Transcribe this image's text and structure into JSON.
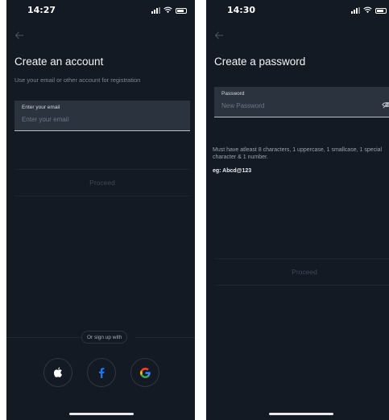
{
  "colors": {
    "background": "#141a24",
    "field_bg": "#2b333f",
    "text_primary": "#f2f4f7",
    "text_muted": "#7c8594",
    "proceed_disabled_text": "#3f4856",
    "facebook_blue": "#1877f2",
    "google_blue": "#4285f4",
    "google_red": "#ea4335",
    "google_yellow": "#fbbc05",
    "google_green": "#34a853"
  },
  "left_screen": {
    "status": {
      "time": "14:27"
    },
    "back_icon": "arrow-left-icon",
    "title": "Create an account",
    "subtitle": "Use your email or other account for registration",
    "email_field": {
      "label": "Enter your email",
      "placeholder": "Enter your email",
      "value": ""
    },
    "proceed_label": "Proceed",
    "or_sign_up": "Or sign up with",
    "social": [
      {
        "name": "apple",
        "icon": "apple-icon"
      },
      {
        "name": "facebook",
        "icon": "facebook-icon"
      },
      {
        "name": "google",
        "icon": "google-icon"
      }
    ]
  },
  "right_screen": {
    "status": {
      "time": "14:30"
    },
    "back_icon": "arrow-left-icon",
    "title": "Create a password",
    "password_field": {
      "label": "Password",
      "placeholder": "New Password",
      "value": "",
      "toggle_icon": "eye-off-icon"
    },
    "hint": "Must have atleast 8 characters, 1 uppercase, 1 smallcase, 1 special character & 1 number.",
    "example": "eg: Abcd@123",
    "proceed_label": "Proceed"
  }
}
